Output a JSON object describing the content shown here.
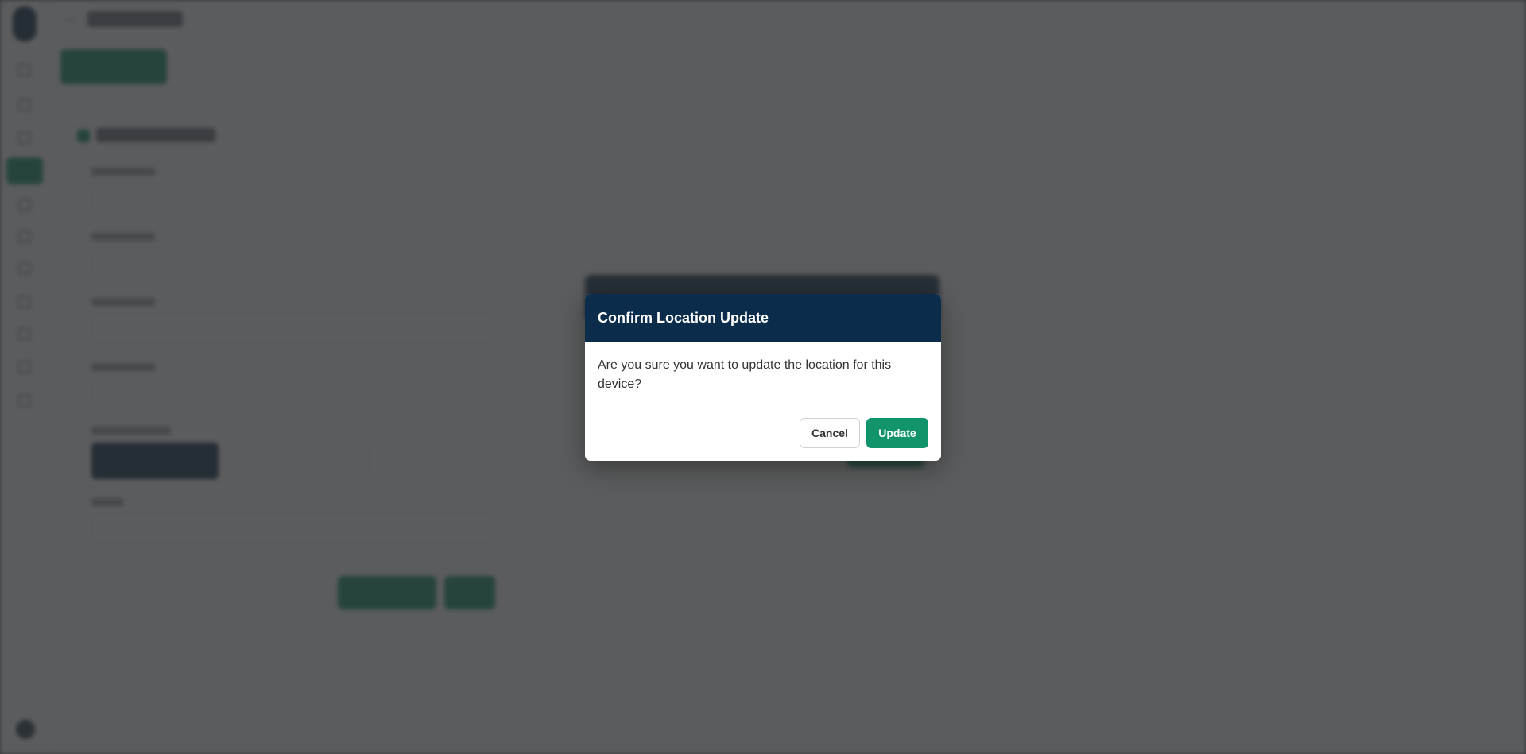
{
  "dialog": {
    "title": "Confirm Location Update",
    "message": "Are you sure you want to update the location for this device?",
    "cancel_label": "Cancel",
    "update_label": "Update"
  },
  "colors": {
    "header_bg": "#0b2d4b",
    "accent_green": "#11936b",
    "overlay": "#2d2e30"
  },
  "icons": {
    "logo": "logo-icon",
    "back": "arrow-left-icon"
  }
}
